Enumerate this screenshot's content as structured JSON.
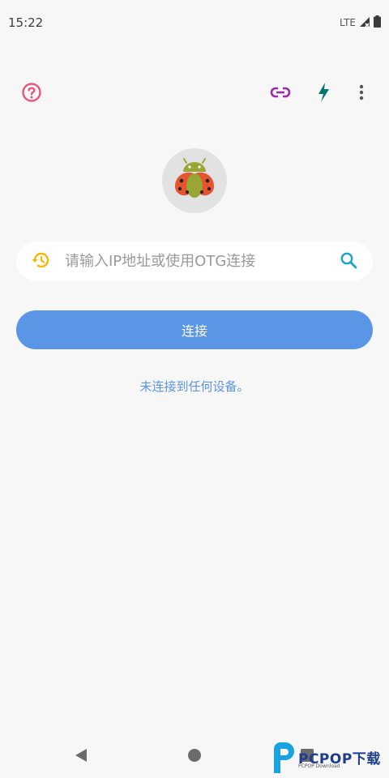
{
  "status_bar": {
    "time": "15:22",
    "network": "LTE"
  },
  "toolbar": {
    "help_icon": "help-circle-icon",
    "link_icon": "link-icon",
    "flash_icon": "flash-icon",
    "more_icon": "more-vertical-icon"
  },
  "app": {
    "logo": "android-ladybug-logo"
  },
  "search": {
    "placeholder": "请输入IP地址或使用OTG连接",
    "value": ""
  },
  "connect_button": {
    "label": "连接"
  },
  "status_message": "未连接到任何设备。",
  "nav_bar": {
    "back": "back-triangle-icon",
    "home": "home-circle-icon",
    "recents": "recents-square-icon"
  },
  "watermark": {
    "text": "PCPOP下载",
    "subtext": "PCPOP Download"
  },
  "colors": {
    "help": "#e8557a",
    "link": "#9c27b0",
    "flash": "#00796b",
    "history": "#f5b800",
    "search": "#1aa3cc",
    "accent": "#5b95e5",
    "background": "#f7f7f7"
  }
}
